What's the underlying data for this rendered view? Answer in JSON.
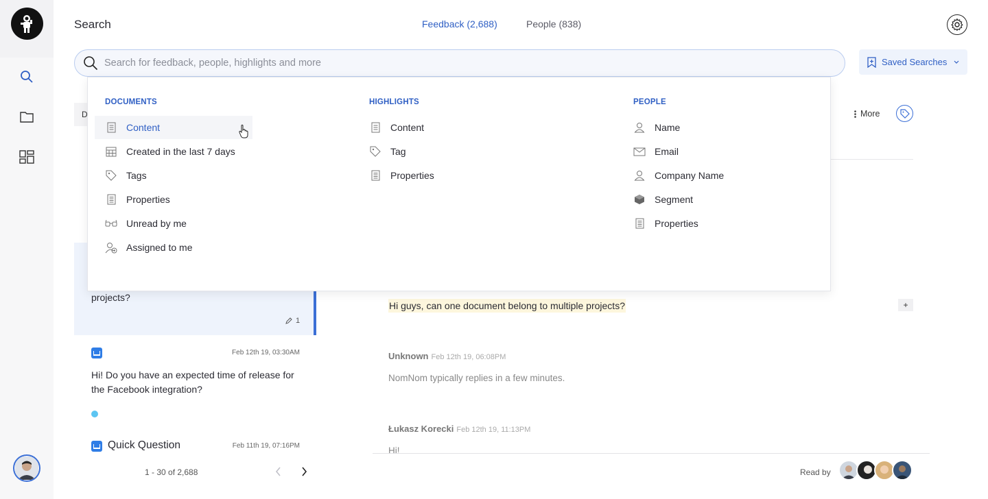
{
  "header": {
    "title": "Search",
    "tabs": [
      {
        "label": "Feedback (2,688)",
        "active": true
      },
      {
        "label": "People (838)",
        "active": false
      }
    ]
  },
  "search": {
    "placeholder": "Search for feedback, people, highlights and more",
    "value": ""
  },
  "saved_searches": {
    "label": "Saved Searches"
  },
  "toolbar": {
    "more_label": "More",
    "docs_tab_initial": "D"
  },
  "dropdown": {
    "documents": {
      "heading": "DOCUMENTS",
      "items": [
        {
          "label": "Content",
          "icon": "document-icon"
        },
        {
          "label": "Created in the last 7 days",
          "icon": "calendar-icon"
        },
        {
          "label": "Tags",
          "icon": "tag-icon"
        },
        {
          "label": "Properties",
          "icon": "properties-icon"
        },
        {
          "label": "Unread by me",
          "icon": "glasses-icon"
        },
        {
          "label": "Assigned to me",
          "icon": "assigned-user-icon"
        }
      ]
    },
    "highlights": {
      "heading": "HIGHLIGHTS",
      "items": [
        {
          "label": "Content",
          "icon": "document-icon"
        },
        {
          "label": "Tag",
          "icon": "tag-icon"
        },
        {
          "label": "Properties",
          "icon": "properties-icon"
        }
      ]
    },
    "people": {
      "heading": "PEOPLE",
      "items": [
        {
          "label": "Name",
          "icon": "user-icon"
        },
        {
          "label": "Email",
          "icon": "mail-icon"
        },
        {
          "label": "Company Name",
          "icon": "user-icon"
        },
        {
          "label": "Segment",
          "icon": "segment-icon"
        },
        {
          "label": "Properties",
          "icon": "properties-icon"
        }
      ]
    }
  },
  "list": {
    "selected": {
      "text": "projects?",
      "highlight_count": "1"
    },
    "items": [
      {
        "date": "Feb 12th 19, 03:30AM",
        "text": "Hi! Do you have an expected time of release for the Facebook integration?",
        "unread": true
      },
      {
        "date": "Feb 11th 19, 07:16PM",
        "title": "Quick Question"
      }
    ],
    "pagination": "1 - 30 of 2,688"
  },
  "conversation": {
    "highlighted_message": "Hi guys, can one document belong to multiple projects?",
    "add_label": "+",
    "messages": [
      {
        "author": "Unknown",
        "time": "Feb 12th 19, 06:08PM",
        "text": "NomNom typically replies in a few minutes."
      },
      {
        "author": "Łukasz Korecki",
        "time": "Feb 12th 19, 11:13PM",
        "text": "Hi!"
      }
    ],
    "read_by_label": "Read by"
  },
  "colors": {
    "accent": "#2f5fc4",
    "highlight": "#fdf6dd",
    "selected_card": "#eef3fc",
    "unread_dot": "#5cc5f2"
  }
}
